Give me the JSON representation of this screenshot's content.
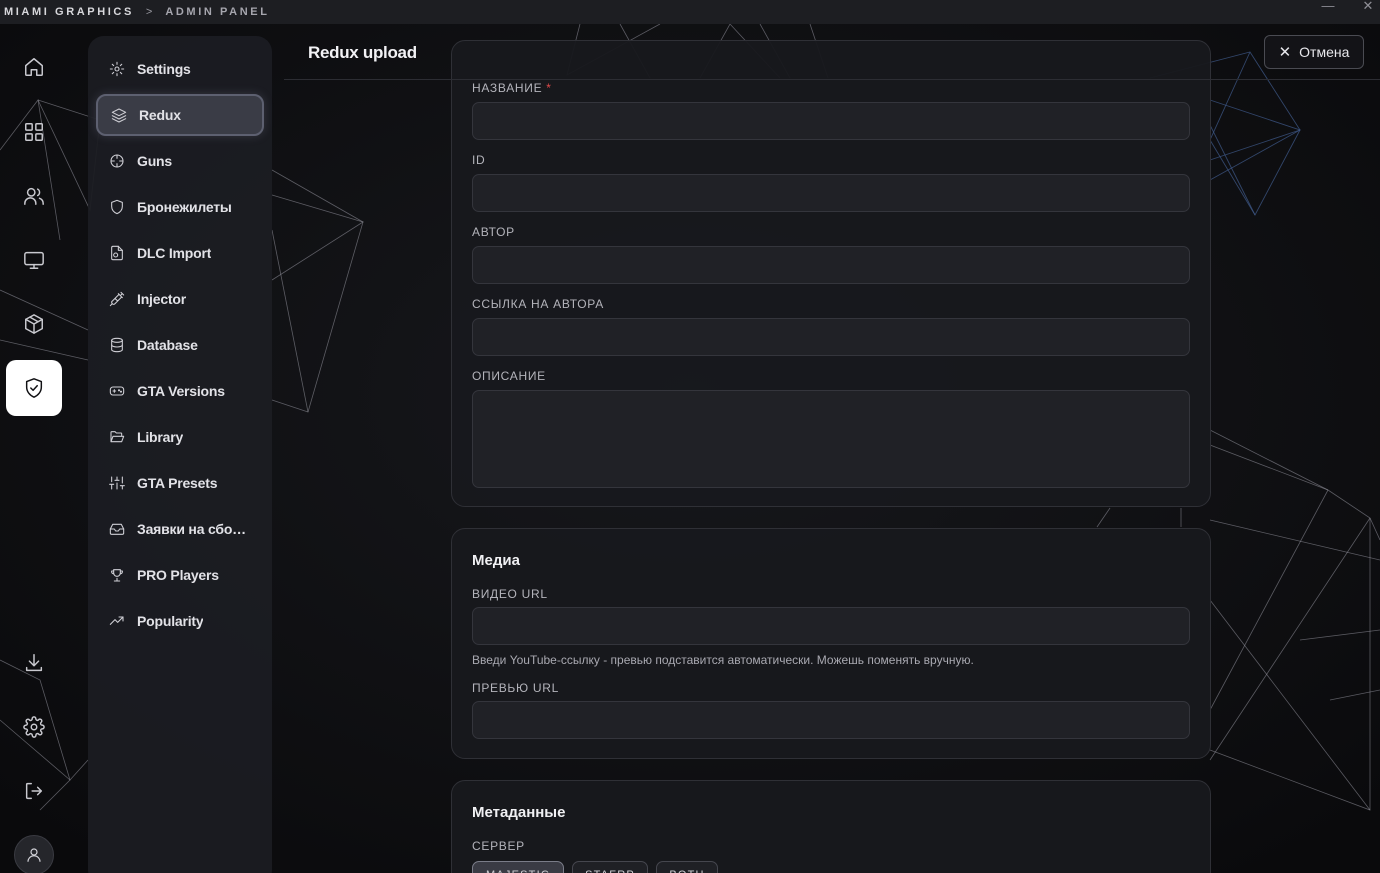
{
  "titlebar": {
    "brand": "MIAMI GRAPHICS",
    "separator": ">",
    "section": "ADMIN PANEL",
    "minimize": "—",
    "close": "✕"
  },
  "rail": {
    "items": [
      {
        "icon": "home-icon"
      },
      {
        "icon": "grid-icon"
      },
      {
        "icon": "users-icon"
      },
      {
        "icon": "monitor-icon"
      },
      {
        "icon": "package-icon"
      },
      {
        "icon": "shield-check-icon",
        "active": true
      },
      {
        "icon": "download-icon"
      },
      {
        "icon": "gear-icon"
      },
      {
        "icon": "logout-icon"
      }
    ]
  },
  "nav": {
    "items": [
      {
        "label": "Settings",
        "icon": "gear-icon"
      },
      {
        "label": "Redux",
        "icon": "layers-icon",
        "active": true
      },
      {
        "label": "Guns",
        "icon": "crosshair-icon"
      },
      {
        "label": "Бронежилеты",
        "icon": "shield-icon"
      },
      {
        "label": "DLC Import",
        "icon": "file-import-icon"
      },
      {
        "label": "Injector",
        "icon": "syringe-icon"
      },
      {
        "label": "Database",
        "icon": "database-icon"
      },
      {
        "label": "GTA Versions",
        "icon": "gamepad-icon"
      },
      {
        "label": "Library",
        "icon": "folder-open-icon"
      },
      {
        "label": "GTA Presets",
        "icon": "sliders-icon"
      },
      {
        "label": "Заявки на сборку",
        "icon": "inbox-icon"
      },
      {
        "label": "PRO Players",
        "icon": "trophy-icon"
      },
      {
        "label": "Popularity",
        "icon": "trending-up-icon"
      }
    ]
  },
  "header": {
    "title": "Redux upload",
    "cancel_label": "Отмена"
  },
  "form": {
    "main": {
      "name_label": "НАЗВАНИЕ",
      "name_required": "*",
      "name_value": "",
      "id_label": "ID",
      "id_value": "",
      "author_label": "АВТОР",
      "author_value": "",
      "author_link_label": "ССЫЛКА НА АВТОРА",
      "author_link_value": "",
      "description_label": "ОПИСАНИЕ",
      "description_value": ""
    },
    "media": {
      "title": "Медиа",
      "video_label": "ВИДЕО URL",
      "video_value": "",
      "video_hint": "Введи YouTube-ссылку - превью подставится автоматически. Можешь поменять вручную.",
      "preview_label": "ПРЕВЬЮ URL",
      "preview_value": ""
    },
    "meta": {
      "title": "Метаданные",
      "server_label": "СЕРВЕР",
      "server_options": [
        "MAJESTIC",
        "STAFRP",
        "BOTH"
      ],
      "server_selected": "MAJESTIC"
    }
  },
  "colors": {
    "accent_active": "#ffffff",
    "required": "#e04a4a",
    "card_bg": "#18191d"
  }
}
